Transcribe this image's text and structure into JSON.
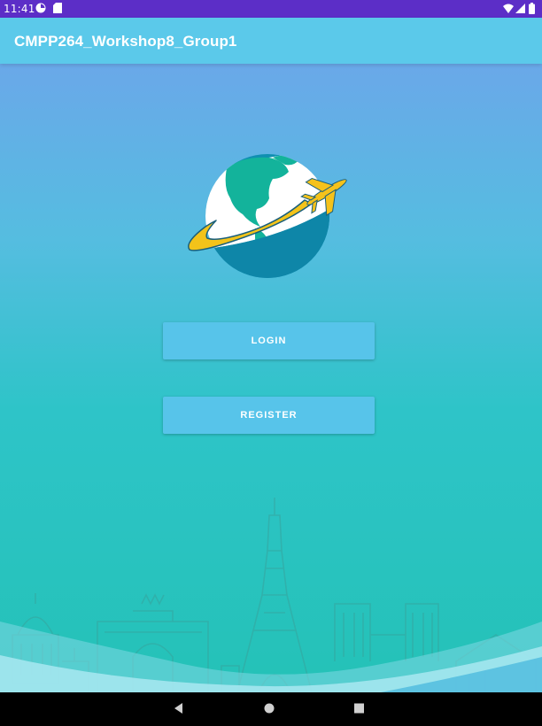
{
  "status_bar": {
    "time": "11:41",
    "left_icons": [
      "timer-icon",
      "sd-card-icon"
    ],
    "right_icons": [
      "wifi-icon",
      "signal-icon",
      "battery-icon"
    ],
    "color": "#5c2ec7"
  },
  "app_bar": {
    "title": "CMPP264_Workshop8_Group1",
    "color": "#5bc9ea"
  },
  "main": {
    "logo": "globe-airplane-logo",
    "login_label": "LOGIN",
    "register_label": "REGISTER",
    "button_color": "#57c4ea"
  },
  "nav_bar": {
    "buttons": [
      "back-icon",
      "home-icon",
      "recents-icon"
    ]
  }
}
